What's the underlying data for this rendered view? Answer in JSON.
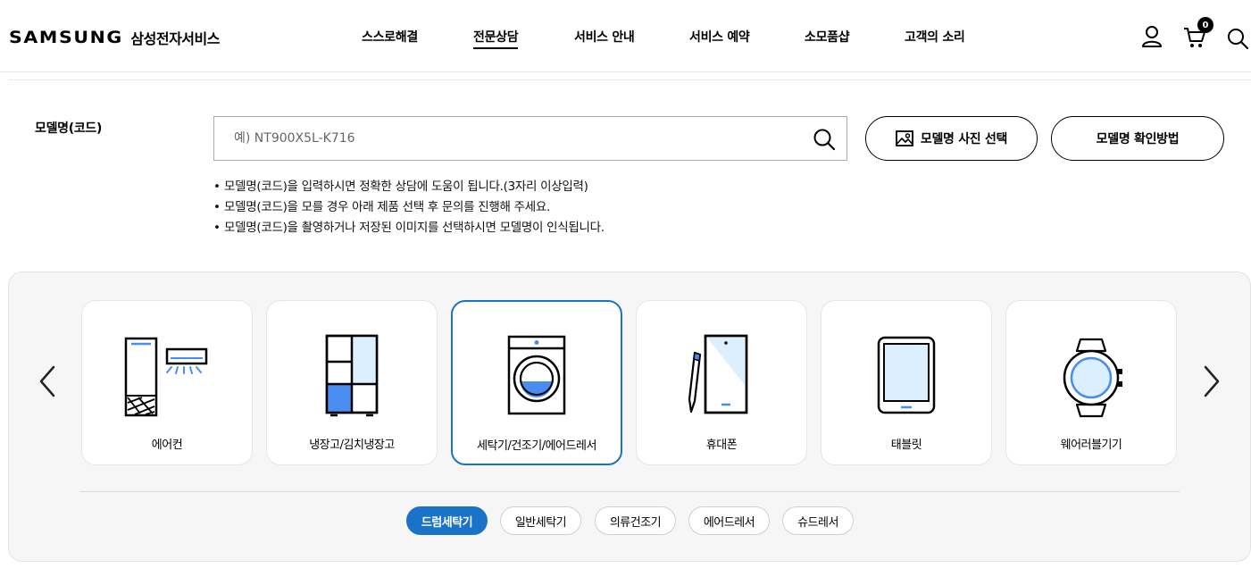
{
  "header": {
    "logo_brand": "SAMSUNG",
    "logo_service": "삼성전자서비스",
    "nav": [
      {
        "label": "스스로해결"
      },
      {
        "label": "전문상담",
        "active": true
      },
      {
        "label": "서비스 안내"
      },
      {
        "label": "서비스 예약"
      },
      {
        "label": "소모품샵"
      },
      {
        "label": "고객의 소리"
      }
    ],
    "cart_count": "0",
    "icons": [
      "user-icon",
      "cart-icon",
      "search-icon"
    ]
  },
  "model_search": {
    "label": "모델명(코드)",
    "placeholder": "예) NT900X5L-K716",
    "photo_button": "모델명 사진 선택",
    "howto_button": "모델명 확인방법",
    "notes": [
      "모델명(코드)을 입력하시면 정확한 상담에 도움이 됩니다.(3자리 이상입력)",
      "모델명(코드)을 모를 경우 아래 제품 선택 후 문의를 진행해 주세요.",
      "모델명(코드)을 촬영하거나 저장된 이미지를 선택하시면 모델명이 인식됩니다."
    ]
  },
  "categories": {
    "items": [
      {
        "label": "에어컨",
        "icon": "air-conditioner-icon"
      },
      {
        "label": "냉장고/김치냉장고",
        "icon": "refrigerator-icon"
      },
      {
        "label": "세탁기/건조기/에어드레서",
        "icon": "washing-machine-icon",
        "selected": true
      },
      {
        "label": "휴대폰",
        "icon": "phone-icon"
      },
      {
        "label": "태블릿",
        "icon": "tablet-icon"
      },
      {
        "label": "웨어러블기기",
        "icon": "watch-icon"
      }
    ],
    "subcategories": [
      {
        "label": "드럼세탁기",
        "active": true
      },
      {
        "label": "일반세탁기"
      },
      {
        "label": "의류건조기"
      },
      {
        "label": "에어드레서"
      },
      {
        "label": "슈드레서"
      }
    ]
  },
  "colors": {
    "accent": "#1a73c8",
    "icon_blue": "#4a8df0",
    "icon_light_blue": "#dcefff",
    "panel_bg": "#f6f6f6"
  }
}
